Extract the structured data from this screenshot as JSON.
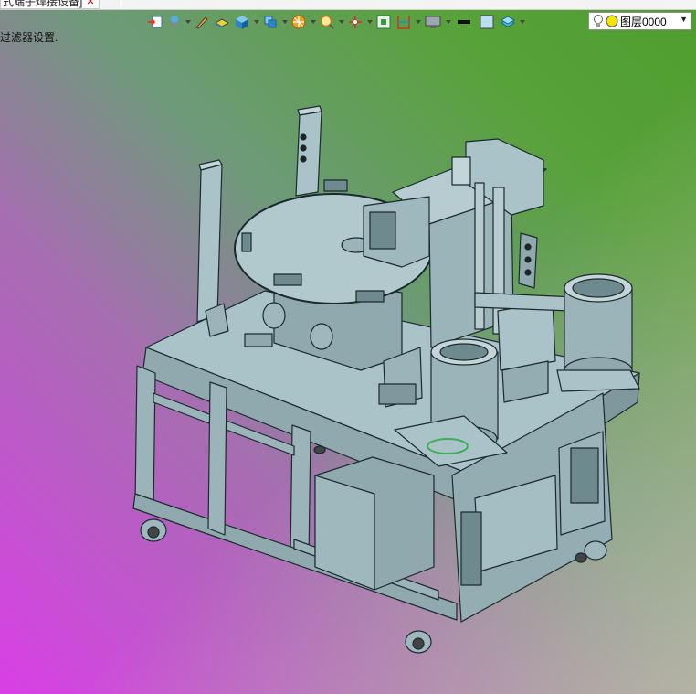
{
  "document_tab": {
    "title": "式端子焊接设备]",
    "close_icon": "close-icon"
  },
  "status": {
    "filter_message": "过滤器设置."
  },
  "toolbar": {
    "items": [
      "move-icon",
      "light-icon",
      "pencil-icon",
      "face-icon",
      "cube-icon",
      "views-icon",
      "render-icon",
      "zoom-icon",
      "axis-icon",
      "fit-icon",
      "section-icon",
      "display-icon",
      "line-style-icon",
      "fill-color-icon",
      "layer-icon"
    ]
  },
  "layer": {
    "label": "图层0000",
    "icons": [
      "bulb-icon",
      "layer-color-icon",
      "dropdown-arrow-icon"
    ]
  },
  "colors": {
    "model": "#a9c3c8",
    "model_shade": "#8fa9ae",
    "model_dark": "#6f8a8e",
    "edge": "#1b2a2e",
    "bg_green": "#4e9e2d",
    "bg_magenta": "#d93fe6"
  }
}
